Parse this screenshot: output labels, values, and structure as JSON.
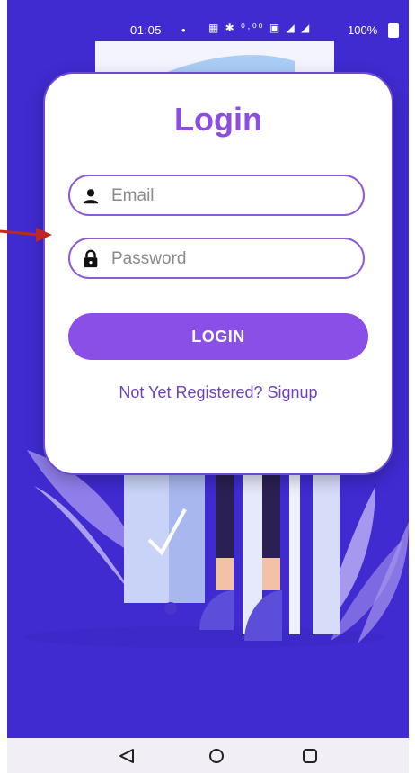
{
  "status_bar": {
    "time": "01:05",
    "dot": "•",
    "icons": "▦ ✱ ⁰·⁰⁰ ▣ ◢ ◢",
    "battery_text": "100%"
  },
  "login_card": {
    "title": "Login",
    "email_placeholder": "Email",
    "password_placeholder": "Password",
    "login_button": "LOGIN",
    "signup_link": "Not Yet Registered? Signup"
  },
  "icons": {
    "email": "person-icon",
    "password": "lock-icon",
    "back": "back-triangle-icon",
    "home": "home-circle-icon",
    "recents": "recents-square-icon"
  },
  "colors": {
    "background": "#3f2bd0",
    "accent": "#8a4fe6",
    "title": "#8c4ee0",
    "link": "#6f43b8",
    "annotation_arrow": "#c0281d"
  }
}
